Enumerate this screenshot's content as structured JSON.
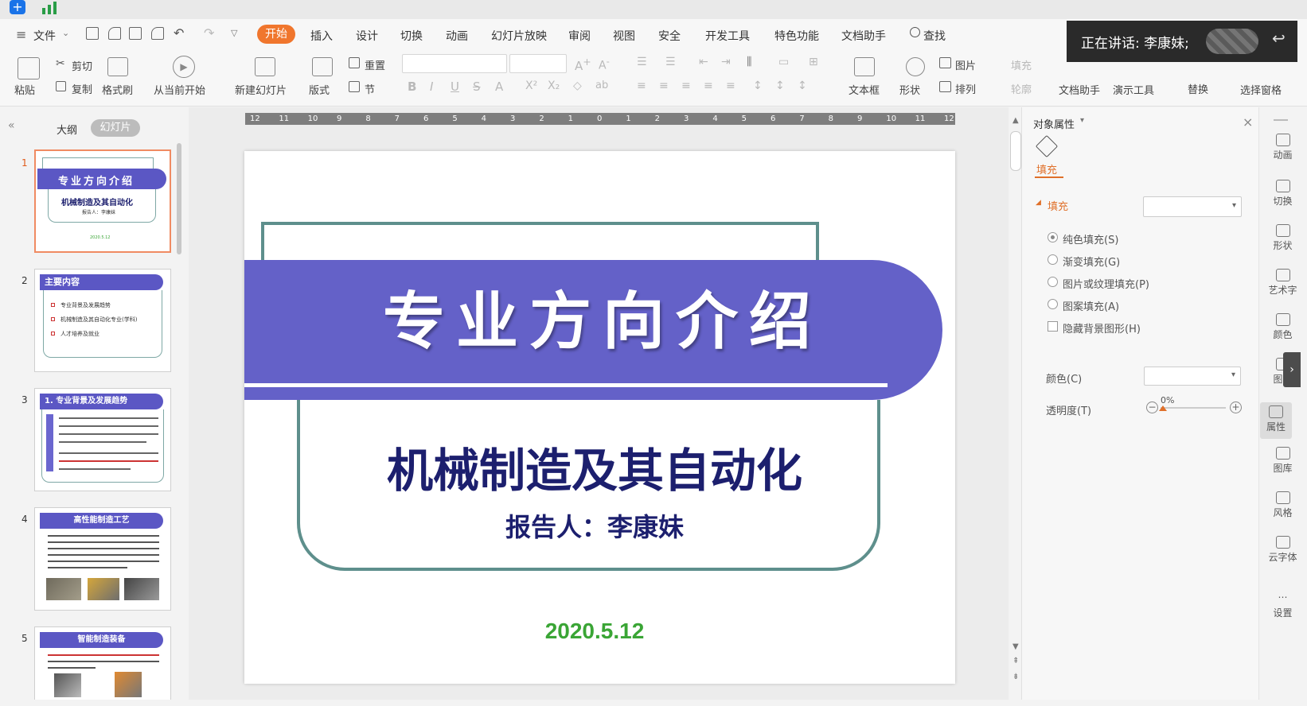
{
  "menubar": {
    "file_label": "文件",
    "tabs": [
      "开始",
      "插入",
      "设计",
      "切换",
      "动画",
      "幻灯片放映",
      "审阅",
      "视图",
      "安全",
      "开发工具",
      "特色功能",
      "文档助手"
    ],
    "search_label": "查找"
  },
  "ribbon": {
    "paste": "粘贴",
    "cut": "剪切",
    "copy": "复制",
    "format_painter": "格式刷",
    "from_current": "从当前开始",
    "new_slide": "新建幻灯片",
    "layout": "版式",
    "reset": "重置",
    "section": "节",
    "textbox": "文本框",
    "shape": "形状",
    "picture": "图片",
    "arrange": "排列",
    "fill": "填充",
    "outline": "轮廓",
    "find": "查找",
    "replace": "替换",
    "doc_assistant": "文档助手",
    "presenter_tools": "演示工具",
    "selection_pane": "选择窗格"
  },
  "speaker_bar": {
    "text": "正在讲话: 李康妹;"
  },
  "left_panel": {
    "tab_outline": "大纲",
    "tab_slides": "幻灯片",
    "thumbnails": [
      {
        "num": "1",
        "title": "专业方向介绍",
        "subtitle": "机械制造及其自动化",
        "reporter": "报告人：李康妹",
        "date": "2020.5.12"
      },
      {
        "num": "2",
        "title": "主要内容",
        "items": [
          "专业背景及发展趋势",
          "机械制造及其自动化专业(学科)",
          "人才培养及就业"
        ]
      },
      {
        "num": "3",
        "title": "1. 专业背景及发展趋势"
      },
      {
        "num": "4",
        "title": "高性能制造工艺"
      },
      {
        "num": "5",
        "title": "智能制造装备"
      }
    ]
  },
  "ruler": {
    "ticks": [
      "12",
      "11",
      "10",
      "9",
      "8",
      "7",
      "6",
      "5",
      "4",
      "3",
      "2",
      "1",
      "0",
      "1",
      "2",
      "3",
      "4",
      "5",
      "6",
      "7",
      "8",
      "9",
      "10",
      "11",
      "12"
    ]
  },
  "slide": {
    "title": "专业方向介绍",
    "subtitle": "机械制造及其自动化",
    "reporter": "报告人：李康妹",
    "date": "2020.5.12"
  },
  "right_panel": {
    "header": "对象属性",
    "tab_fill": "填充",
    "section_fill": "填充",
    "options": [
      "纯色填充(S)",
      "渐变填充(G)",
      "图片或纹理填充(P)",
      "图案填充(A)"
    ],
    "hide_bg": "隐藏背景图形(H)",
    "color_label": "颜色(C)",
    "transparency_label": "透明度(T)",
    "transparency_value": "0%"
  },
  "sidebar": {
    "items": [
      "动画",
      "切换",
      "形状",
      "艺术字",
      "颜色",
      "图表",
      "属性",
      "图库",
      "风格",
      "云字体",
      "设置"
    ]
  },
  "colors": {
    "accent_orange": "#f0762d",
    "banner_purple": "#5b57c4",
    "frame_teal": "#5e8f8c",
    "title_navy": "#1c1f6e",
    "date_green": "#3aa535"
  }
}
